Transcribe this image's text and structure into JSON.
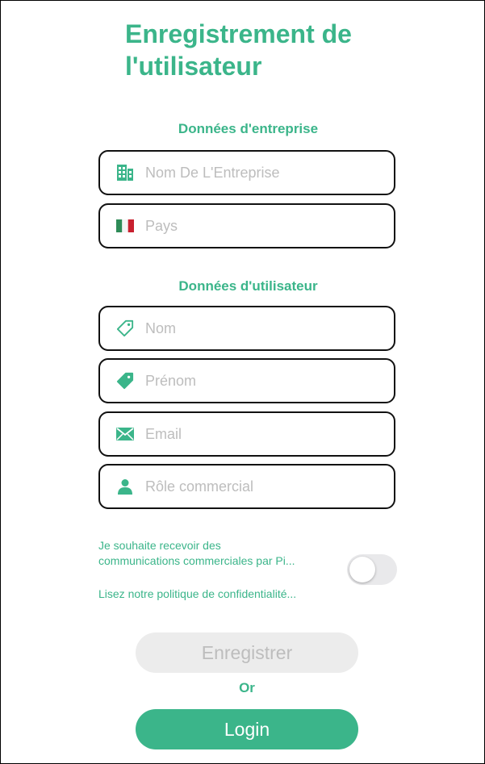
{
  "header": {
    "title_line1": "Enregistrement de",
    "title_line2": "l'utilisateur"
  },
  "company_section": {
    "heading": "Données d'entreprise",
    "company_name": {
      "placeholder": "Nom De L'Entreprise",
      "icon": "building-icon"
    },
    "country": {
      "placeholder": "Pays",
      "icon": "italy-flag-icon"
    }
  },
  "user_section": {
    "heading": "Données d'utilisateur",
    "last_name": {
      "placeholder": "Nom",
      "icon": "tag-outline-icon"
    },
    "first_name": {
      "placeholder": "Prénom",
      "icon": "tag-filled-icon"
    },
    "email": {
      "placeholder": "Email",
      "icon": "envelope-icon"
    },
    "role": {
      "placeholder": "Rôle commercial",
      "icon": "person-icon"
    }
  },
  "consent": {
    "text_line1": "Je souhaite recevoir des",
    "text_line2": "communications commerciales par Pi...",
    "privacy_link": "Lisez notre politique de confidentialité...",
    "toggle_on": false
  },
  "actions": {
    "register_label": "Enregistrer",
    "or_label": "Or",
    "login_label": "Login"
  },
  "colors": {
    "accent": "#3bb58a",
    "disabled_bg": "#ececec",
    "disabled_text": "#bdbdbd"
  }
}
